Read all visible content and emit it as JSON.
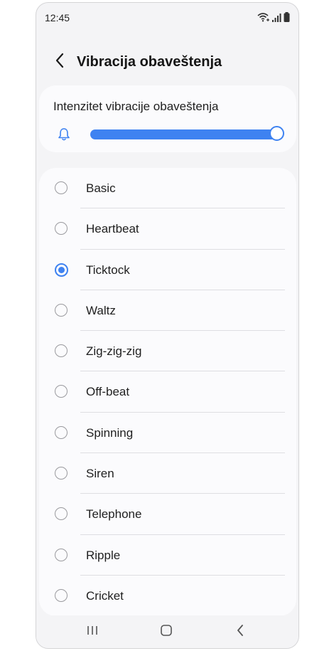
{
  "status_bar": {
    "time": "12:45"
  },
  "header": {
    "title": "Vibracija obaveštenja"
  },
  "intensity": {
    "label": "Intenzitet vibracije obaveštenja",
    "level_percent": 100
  },
  "patterns": {
    "selected": "Ticktock",
    "items": [
      {
        "label": "Basic"
      },
      {
        "label": "Heartbeat"
      },
      {
        "label": "Ticktock"
      },
      {
        "label": "Waltz"
      },
      {
        "label": "Zig-zig-zig"
      },
      {
        "label": "Off-beat"
      },
      {
        "label": "Spinning"
      },
      {
        "label": "Siren"
      },
      {
        "label": "Telephone"
      },
      {
        "label": "Ripple"
      },
      {
        "label": "Cricket"
      }
    ]
  },
  "colors": {
    "accent": "#3e82f1",
    "background": "#f4f4f6",
    "card": "#fbfbfd"
  },
  "icons": {
    "status": [
      "wifi-icon",
      "signal-icon",
      "battery-icon"
    ],
    "header": "back-arrow-icon",
    "intensity": "bell-icon",
    "nav": [
      "recent-apps-icon",
      "home-icon",
      "back-icon"
    ]
  }
}
